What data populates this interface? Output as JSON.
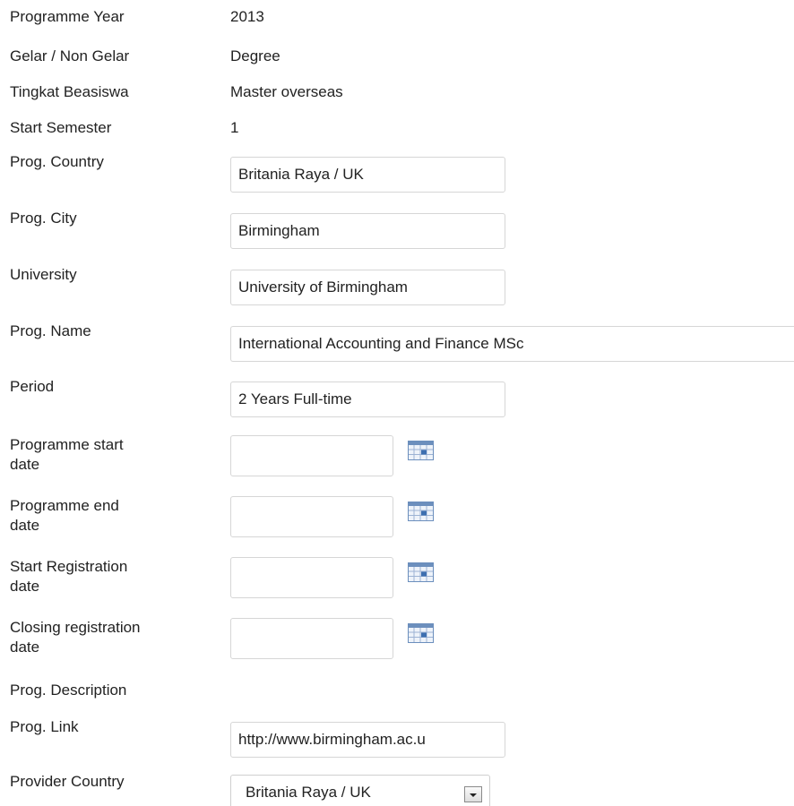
{
  "fields": {
    "programme_year": {
      "label": "Programme Year",
      "value": "2013"
    },
    "gelar": {
      "label": "Gelar / Non Gelar",
      "value": "Degree"
    },
    "tingkat": {
      "label": "Tingkat Beasiswa",
      "value": "Master overseas"
    },
    "start_semester": {
      "label": "Start Semester",
      "value": "1"
    },
    "prog_country": {
      "label": "Prog. Country",
      "value": "Britania Raya / UK"
    },
    "prog_city": {
      "label": "Prog. City",
      "value": "Birmingham"
    },
    "university": {
      "label": "University",
      "value": "University of Birmingham"
    },
    "prog_name": {
      "label": "Prog. Name",
      "value": "International Accounting and Finance MSc"
    },
    "period": {
      "label": "Period",
      "value": "2 Years Full-time"
    },
    "programme_start_date": {
      "label_line1": "Programme start",
      "label_line2": "date",
      "value": ""
    },
    "programme_end_date": {
      "label_line1": "Programme end",
      "label_line2": "date",
      "value": ""
    },
    "start_registration_date": {
      "label_line1": "Start Registration",
      "label_line2": "date",
      "value": ""
    },
    "closing_registration_date": {
      "label_line1": "Closing registration",
      "label_line2": "date",
      "value": ""
    },
    "prog_description": {
      "label": "Prog. Description"
    },
    "prog_link": {
      "label": "Prog. Link",
      "value": "http://www.birmingham.ac.u"
    },
    "provider_country": {
      "label": "Provider Country",
      "selected": "Britania Raya / UK"
    }
  },
  "icons": {
    "calendar": "calendar-icon",
    "dropdown": "chevron-down-icon"
  }
}
